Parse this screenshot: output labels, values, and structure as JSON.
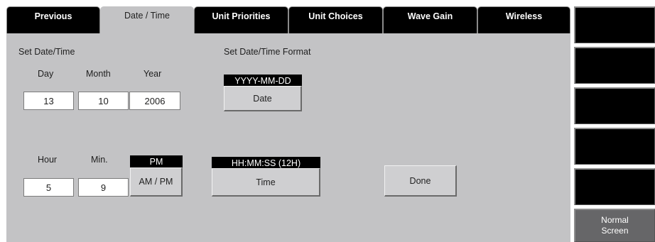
{
  "tabs": [
    {
      "label": "Previous"
    },
    {
      "label": "Date / Time"
    },
    {
      "label": "Unit Priorities"
    },
    {
      "label": "Unit Choices"
    },
    {
      "label": "Wave Gain"
    },
    {
      "label": "Wireless"
    }
  ],
  "date_section": {
    "title": "Set Date/Time",
    "day_label": "Day",
    "month_label": "Month",
    "year_label": "Year",
    "day": "13",
    "month": "10",
    "year": "2006"
  },
  "date_format": {
    "title": "Set Date/Time Format",
    "current": "YYYY-MM-DD",
    "button": "Date"
  },
  "time_section": {
    "hour_label": "Hour",
    "min_label": "Min.",
    "hour": "5",
    "minute": "9",
    "ampm_current": "PM",
    "ampm_button": "AM / PM"
  },
  "time_format": {
    "current": "HH:MM:SS (12H)",
    "button": "Time"
  },
  "done_button": "Done",
  "softkeys": {
    "normal_screen_line1": "Normal",
    "normal_screen_line2": "Screen"
  },
  "colors": {
    "panel": "#c3c3c5",
    "tab": "#000000",
    "field": "#ffffff",
    "softkey_active": "#666668"
  }
}
